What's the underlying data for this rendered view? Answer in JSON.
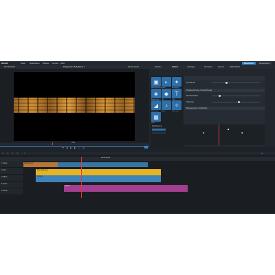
{
  "app": {
    "logo": "MAGIX",
    "menu": [
      "Datei",
      "Bearbeiten",
      "Effekte",
      "Fenster",
      "Hilfe"
    ],
    "right_buttons": [
      "Bearbeiten",
      "Exportieren"
    ]
  },
  "preview": {
    "left_time": "00:00:00:00",
    "title": "Programm: Aufnahme *",
    "right_time": "00:00:12:00",
    "zoom_label": "0:00",
    "accent": "#3a86c9"
  },
  "effects": {
    "tabs": [
      "Medien",
      "Effekte"
    ],
    "tiles": [
      {
        "label": "Bildoptimierung",
        "icon": "▣"
      },
      {
        "label": "Farbe",
        "icon": "◐"
      },
      {
        "label": "Bewegung",
        "icon": "✦"
      },
      {
        "label": "Anpassung",
        "icon": "◈"
      },
      {
        "label": "Stil",
        "icon": "◆"
      },
      {
        "label": "Titel",
        "icon": "T"
      },
      {
        "label": "Übergang",
        "icon": "◢"
      },
      {
        "label": "Audio",
        "icon": "♪"
      },
      {
        "label": "Dekoration",
        "icon": "✧"
      },
      {
        "label": "Filter",
        "icon": "▦"
      }
    ]
  },
  "properties": {
    "tabs": [
      "Vorlagen",
      "Tonhöhe",
      "Sound",
      "HDR Effekt"
    ],
    "group1_label": "Deckkraft",
    "group1_sub": "Positionierung / Ausrichtung",
    "group2_label": "Randschärfe",
    "group3_label": "Vignette",
    "group4_label": "Bewegungs-Unschärfe",
    "keyframe_label": "Keyframes"
  },
  "timeline": {
    "ruler_time": "00:00:08:00",
    "tracks": [
      {
        "label": "1 Video"
      },
      {
        "label": "2 Titel"
      },
      {
        "label": "3 Effekt"
      },
      {
        "label": "4 Audio"
      },
      {
        "label": "5 Musik"
      }
    ],
    "clips": {
      "orange": "Anfang.mov",
      "yellow": "Titel_Clip.png",
      "blue": "Overlay",
      "magenta": "Musik"
    },
    "colors": {
      "orange": "#b7753a",
      "yellow": "#e6b422",
      "blue": "#3f84b8",
      "magenta": "#a23f8e"
    }
  }
}
